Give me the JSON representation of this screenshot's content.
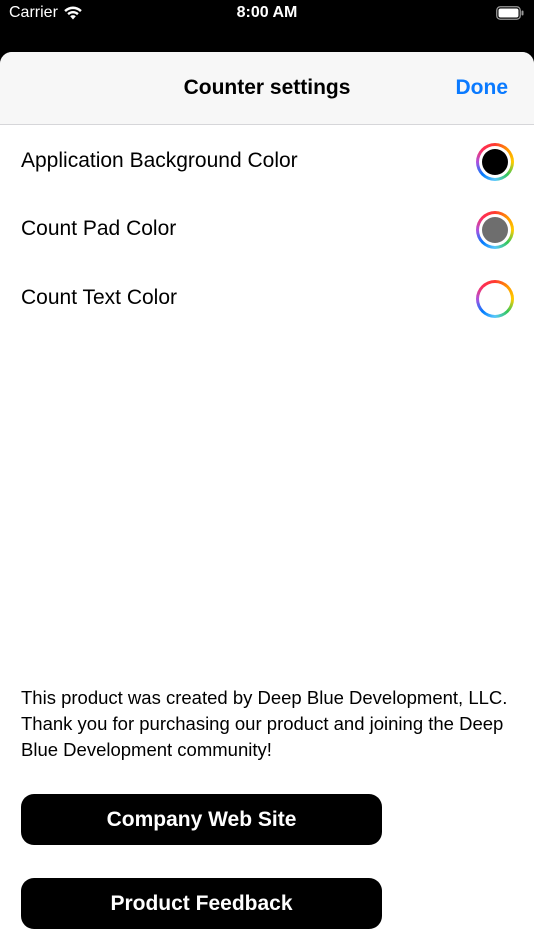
{
  "status_bar": {
    "carrier": "Carrier",
    "time": "8:00 AM",
    "wifi_icon": "wifi-icon",
    "battery_icon": "battery-icon"
  },
  "nav": {
    "title": "Counter settings",
    "done_label": "Done"
  },
  "settings": [
    {
      "label": "Application Background Color",
      "swatch_color": "#000000"
    },
    {
      "label": "Count Pad Color",
      "swatch_color": "#6e6e6e"
    },
    {
      "label": "Count Text Color",
      "swatch_color": "#ffffff"
    }
  ],
  "about": {
    "text": "This product was created by Deep Blue Development, LLC. Thank you for purchasing our product and joining the Deep Blue Development community!"
  },
  "buttons": {
    "company_web_site": "Company Web Site",
    "product_feedback": "Product Feedback"
  },
  "colors": {
    "accent": "#0a7aff",
    "button_background": "#000000",
    "nav_background": "#f7f7f7"
  }
}
